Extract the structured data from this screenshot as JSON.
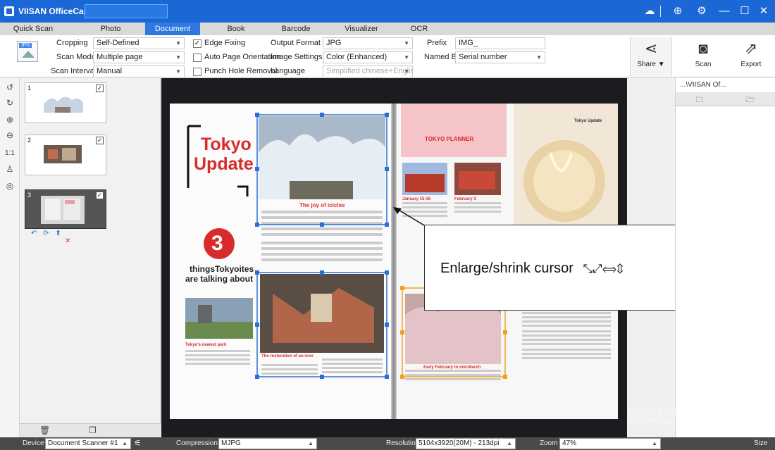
{
  "app": {
    "title": "VIISAN OfficeCam"
  },
  "tabs": [
    "Quick Scan",
    "Photo",
    "Document",
    "Book",
    "Barcode",
    "Visualizer",
    "OCR"
  ],
  "active_tab": "Document",
  "toolbar": {
    "format_tag": "JPG",
    "cropping_label": "Cropping",
    "cropping_value": "Self-Defined",
    "scan_mode_label": "Scan Mode",
    "scan_mode_value": "Multiple page",
    "scan_interval_label": "Scan Interval",
    "scan_interval_value": "Manual",
    "edge_fixing": "Edge Fixing",
    "auto_orientation": "Auto Page Orientation",
    "punch_hole": "Punch Hole Removal",
    "output_format_label": "Output Format",
    "output_format_value": "JPG",
    "image_settings_label": "Image Settings",
    "image_settings_value": "Color (Enhanced)",
    "language_label": "Language",
    "language_value": "Simplified chinese+English",
    "prefix_label": "Prefix",
    "prefix_value": "IMG_",
    "named_by_label": "Named By",
    "named_by_value": "Serial number",
    "share_label": "Share ▼",
    "scan_label": "Scan",
    "export_label": "Export"
  },
  "thumbnails": [
    {
      "num": "1",
      "checked": "✓"
    },
    {
      "num": "2",
      "checked": "✓"
    },
    {
      "num": "3",
      "checked": "✓"
    }
  ],
  "right_pane": {
    "path": "...\\VIISAN Of..."
  },
  "magazine": {
    "tokyo": "Tokyo",
    "update": "Update",
    "big_number": "3",
    "things": "thingsTokyoites",
    "talking": "are talking about",
    "joy": "The joy of icicles",
    "restoration": "The restoration of an icon",
    "park": "Tokyo's newest park",
    "planner": "TOKYO PLANNER",
    "header_right": "Tokyo Update",
    "january": "January 15-16",
    "february": "February 3",
    "early": "Early February to mid-March"
  },
  "callout": {
    "text": "Enlarge/shrink cursor",
    "arrows": "⤡⤢⟺⇕"
  },
  "status": {
    "device_label": "Device",
    "device_value": "Document Scanner #1",
    "compression_label": "Compression",
    "compression_value": "MJPG",
    "resolution_label": "Resolution",
    "resolution_value": "5104x3920(20M) - 213dpi",
    "zoom_label": "Zoom",
    "zoom_value": "47%",
    "size_label": "Size"
  },
  "watermark": {
    "line1": "Activate Windows",
    "line2": "Go to Settings to activate Windows."
  },
  "colors": {
    "titlebar": "#1b67d6",
    "active_tab": "#2f78e0",
    "accent_red": "#d82c2c",
    "selection_blue": "#2b6fd6",
    "selection_orange": "#f0a020"
  }
}
